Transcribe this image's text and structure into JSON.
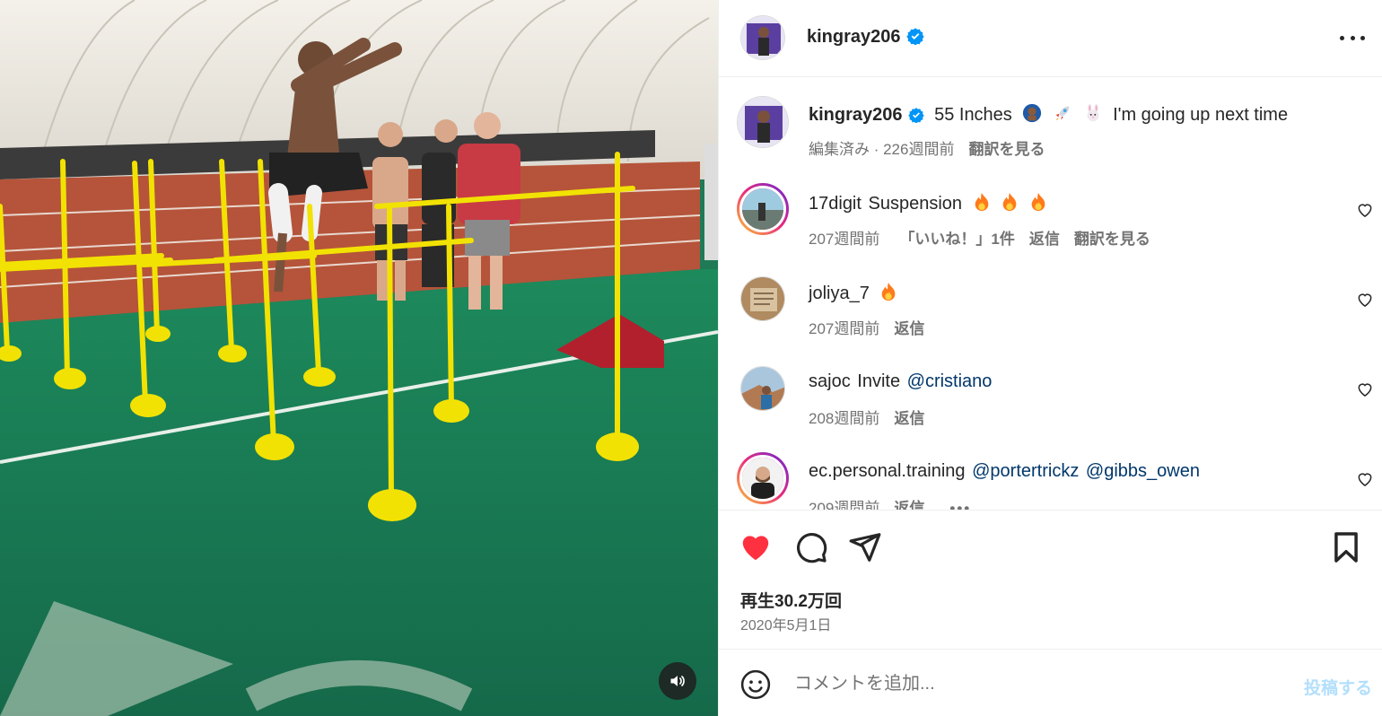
{
  "post": {
    "author": "kingray206",
    "author_verified": true,
    "caption": {
      "username": "kingray206",
      "text": "55 Inches",
      "emojis": [
        "person-emoji",
        "rocket-emoji",
        "rabbit-emoji"
      ],
      "text_after": "I'm going up next time",
      "time": "編集済み · 226週間前",
      "translate": "翻訳を見る"
    },
    "views": "再生30.2万回",
    "date": "2020年5月1日"
  },
  "comments": [
    {
      "username": "17digit",
      "text": "Suspension",
      "emoji": "fire-emoji",
      "emoji_count": 3,
      "time": "207週間前",
      "likes": "「いいね！」1件",
      "reply": "返信",
      "translate": "翻訳を見る",
      "has_story_ring": true
    },
    {
      "username": "joliya_7",
      "text": "",
      "emoji": "fire-emoji",
      "emoji_count": 1,
      "time": "207週間前",
      "likes": "",
      "reply": "返信",
      "translate": "",
      "has_story_ring": false
    },
    {
      "username": "sajoc",
      "text": "Invite",
      "mentions": [
        "@cristiano"
      ],
      "time": "208週間前",
      "likes": "",
      "reply": "返信",
      "translate": "",
      "has_story_ring": false
    },
    {
      "username": "ec.personal.training",
      "text": "",
      "mentions": [
        "@portertrickz",
        "@gibbs_owen"
      ],
      "time": "209週間前",
      "likes": "",
      "reply": "返信",
      "translate": "",
      "has_story_ring": true,
      "has_more": true
    }
  ],
  "composer": {
    "placeholder": "コメントを追加...",
    "post_label": "投稿する"
  },
  "colors": {
    "like_active": "#ff3040",
    "link": "#00376b",
    "verified": "#0095f6",
    "post_disabled": "#b2dffc"
  }
}
